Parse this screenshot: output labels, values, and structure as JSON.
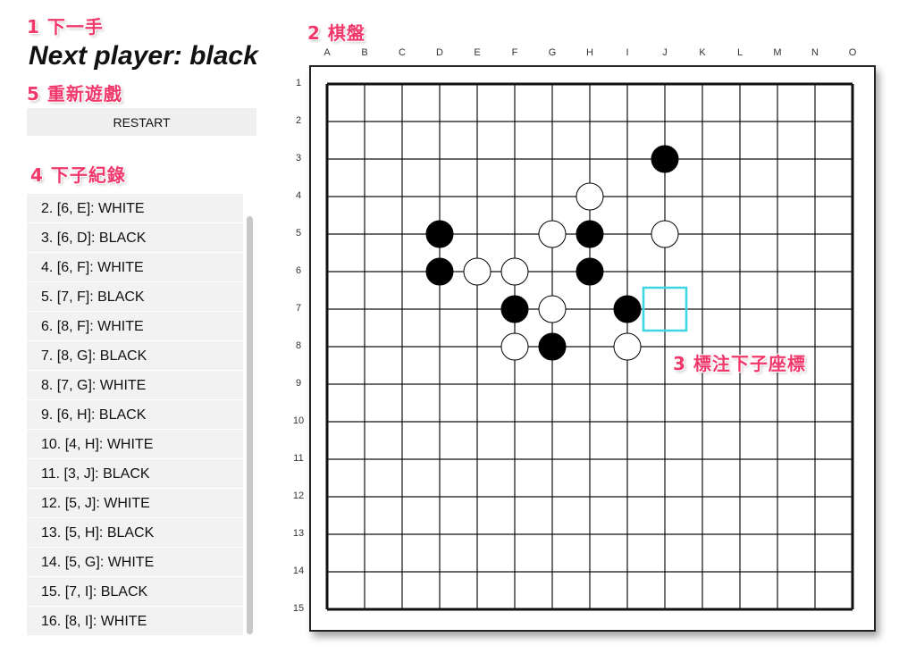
{
  "annotations": {
    "next_move": "1 下一手",
    "board": "2 棋盤",
    "coord_mark": "3 標注下子座標",
    "history": "4 下子紀錄",
    "restart": "5 重新遊戲"
  },
  "status": "Next player: black",
  "restart_label": "RESTART",
  "history": [
    "2. [6, E]: WHITE",
    "3. [6, D]: BLACK",
    "4. [6, F]: WHITE",
    "5. [7, F]: BLACK",
    "6. [8, F]: WHITE",
    "7. [8, G]: BLACK",
    "8. [7, G]: WHITE",
    "9. [6, H]: BLACK",
    "10. [4, H]: WHITE",
    "11. [3, J]: BLACK",
    "12. [5, J]: WHITE",
    "13. [5, H]: BLACK",
    "14. [5, G]: WHITE",
    "15. [7, I]: BLACK",
    "16. [8, I]: WHITE"
  ],
  "board": {
    "columns": [
      "A",
      "B",
      "C",
      "D",
      "E",
      "F",
      "G",
      "H",
      "I",
      "J",
      "K",
      "L",
      "M",
      "N",
      "O"
    ],
    "rows": [
      "1",
      "2",
      "3",
      "4",
      "5",
      "6",
      "7",
      "8",
      "9",
      "10",
      "11",
      "12",
      "13",
      "14",
      "15"
    ],
    "stones": [
      {
        "row": 3,
        "col": "J",
        "color": "black"
      },
      {
        "row": 4,
        "col": "H",
        "color": "white"
      },
      {
        "row": 5,
        "col": "D",
        "color": "black"
      },
      {
        "row": 5,
        "col": "G",
        "color": "white"
      },
      {
        "row": 5,
        "col": "H",
        "color": "black"
      },
      {
        "row": 5,
        "col": "J",
        "color": "white"
      },
      {
        "row": 6,
        "col": "D",
        "color": "black"
      },
      {
        "row": 6,
        "col": "E",
        "color": "white"
      },
      {
        "row": 6,
        "col": "F",
        "color": "white"
      },
      {
        "row": 6,
        "col": "H",
        "color": "black"
      },
      {
        "row": 7,
        "col": "F",
        "color": "black"
      },
      {
        "row": 7,
        "col": "G",
        "color": "white"
      },
      {
        "row": 7,
        "col": "I",
        "color": "black"
      },
      {
        "row": 8,
        "col": "F",
        "color": "white"
      },
      {
        "row": 8,
        "col": "G",
        "color": "black"
      },
      {
        "row": 8,
        "col": "I",
        "color": "white"
      }
    ],
    "hover": {
      "row": 7,
      "col": "J"
    },
    "colors": {
      "hover": "#3dd6e0",
      "annotation": "#f0386b",
      "black_stone": "#000000",
      "white_stone": "#ffffff"
    }
  }
}
